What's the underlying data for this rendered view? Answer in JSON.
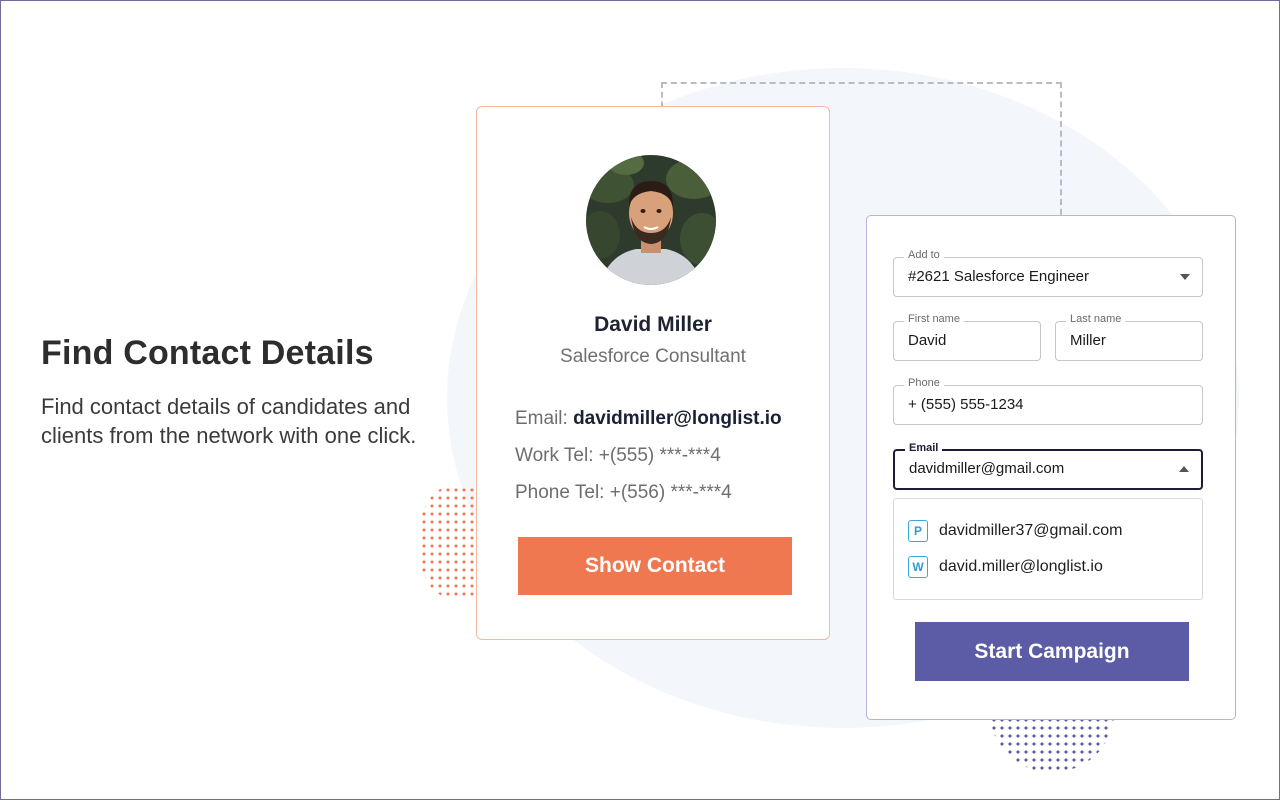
{
  "hero": {
    "title": "Find Contact Details",
    "description": "Find contact details of candidates and clients from the network with one click."
  },
  "profile": {
    "name": "David Miller",
    "role": "Salesforce Consultant",
    "email_label": "Email:",
    "email_value": "davidmiller@longlist.io",
    "work_tel_label": "Work Tel:",
    "work_tel_value": "+(555) ***-***4",
    "phone_tel_label": "Phone Tel:",
    "phone_tel_value": "+(556) ***-***4",
    "show_button": "Show Contact"
  },
  "form": {
    "add_to": {
      "label": "Add to",
      "value": "#2621 Salesforce Engineer"
    },
    "first_name": {
      "label": "First name",
      "value": "David"
    },
    "last_name": {
      "label": "Last name",
      "value": "Miller"
    },
    "phone": {
      "label": "Phone",
      "value": "+ (555) 555-1234"
    },
    "email": {
      "label": "Email",
      "value": "davidmiller@gmail.com"
    },
    "email_options": [
      {
        "badge": "P",
        "value": "davidmiller37@gmail.com"
      },
      {
        "badge": "W",
        "value": "david.miller@longlist.io"
      }
    ],
    "campaign_button": "Start Campaign"
  },
  "colors": {
    "accent_orange": "#f07850",
    "accent_purple": "#5b5ba6",
    "badge_blue": "#2f9fd0"
  }
}
